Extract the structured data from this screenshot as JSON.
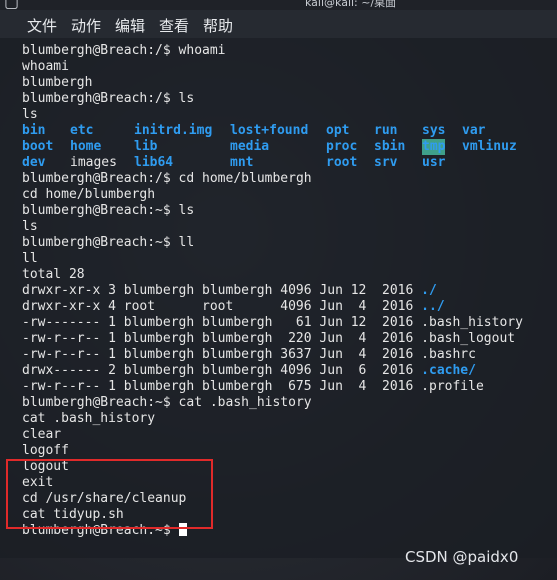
{
  "window": {
    "title": "kali@kali: ~/桌面"
  },
  "menu": {
    "file": "文件",
    "actions": "动作",
    "edit": "编辑",
    "view": "查看",
    "help": "帮助"
  },
  "terminal": {
    "prompt_root": "blumbergh@Breach:/$ ",
    "prompt_home": "blumbergh@Breach:~$ ",
    "cmd_whoami": "whoami",
    "echo_whoami": "whoami",
    "out_whoami": "blumbergh",
    "cmd_ls": "ls",
    "echo_ls": "ls",
    "ls_rows": [
      [
        "bin",
        "etc",
        "initrd.img",
        "lost+found",
        "opt",
        "run",
        "sys",
        "var"
      ],
      [
        "boot",
        "home",
        "lib",
        "media",
        "proc",
        "sbin",
        "tmp",
        "vmlinuz"
      ],
      [
        "dev",
        "images",
        "lib64",
        "mnt",
        "root",
        "srv",
        "usr",
        ""
      ]
    ],
    "cmd_cd": "cd home/blumbergh",
    "echo_cd": "cd home/blumbergh",
    "cmd_ls2": "ls",
    "echo_ls2": "ls",
    "cmd_ll": "ll",
    "echo_ll": "ll",
    "total": "total 28",
    "ll_rows": [
      {
        "perm": "drwxr-xr-x 3 blumbergh blumbergh 4096 Jun 12  2016 ",
        "name": "./",
        "dir": true
      },
      {
        "perm": "drwxr-xr-x 4 root      root      4096 Jun  4  2016 ",
        "name": "../",
        "dir": true
      },
      {
        "perm": "-rw------- 1 blumbergh blumbergh   61 Jun 12  2016 ",
        "name": ".bash_history",
        "dir": false
      },
      {
        "perm": "-rw-r--r-- 1 blumbergh blumbergh  220 Jun  4  2016 ",
        "name": ".bash_logout",
        "dir": false
      },
      {
        "perm": "-rw-r--r-- 1 blumbergh blumbergh 3637 Jun  4  2016 ",
        "name": ".bashrc",
        "dir": false
      },
      {
        "perm": "drwx------ 2 blumbergh blumbergh 4096 Jun  6  2016 ",
        "name": ".cache/",
        "dir": true
      },
      {
        "perm": "-rw-r--r-- 1 blumbergh blumbergh  675 Jun  4  2016 ",
        "name": ".profile",
        "dir": false
      }
    ],
    "cmd_cat": "cat .bash_history",
    "history": [
      "cat .bash_history",
      "clear",
      "logoff",
      "logout",
      "exit",
      "cd /usr/share/cleanup",
      "cat tidyup.sh"
    ],
    "final_prompt": "blumbergh@Breach:~$ "
  },
  "watermark": "CSDN @paidx0",
  "colors": {
    "dir": "#2f9cf0",
    "highlight": "#e02a2a",
    "text": "#e6e6e6"
  }
}
